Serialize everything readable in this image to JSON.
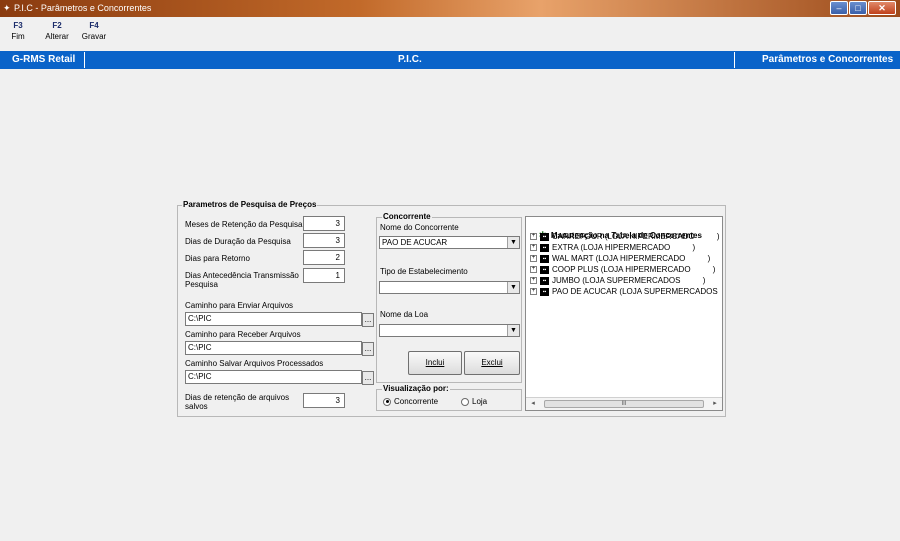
{
  "window": {
    "title": "P.I.C - Parâmetros e Concorrentes",
    "controls": {
      "minimize": "–",
      "maximize": "□",
      "close": "✕"
    }
  },
  "toolbar": [
    {
      "key": "F3",
      "label": "Fim"
    },
    {
      "key": "F2",
      "label": "Alterar"
    },
    {
      "key": "F4",
      "label": "Gravar"
    }
  ],
  "banner": {
    "left": "G-RMS Retail",
    "center": "P.I.C.",
    "right": "Parâmetros e Concorrentes",
    "color": "#0a63c9"
  },
  "params": {
    "legend": "Parametros de Pesquisa de Preços",
    "fields": [
      {
        "label": "Meses de Retenção da Pesquisa",
        "value": "3"
      },
      {
        "label": "Dias de Duração da Pesquisa",
        "value": "3"
      },
      {
        "label": "Dias para Retorno",
        "value": "2"
      },
      {
        "label": "Dias Antecedência Transmissão Pesquisa",
        "value": "1"
      }
    ],
    "paths": [
      {
        "label": "Caminho para Enviar Arquivos",
        "value": "C:\\PIC",
        "button": "..."
      },
      {
        "label": "Caminho para Receber Arquivos",
        "value": "C:\\PIC",
        "button": "..."
      },
      {
        "label": "Caminho Salvar Arquivos Processados",
        "value": "C:\\PIC",
        "button": "..."
      }
    ],
    "retention": {
      "label": "Dias de retenção de arquivos salvos",
      "value": "3"
    }
  },
  "concorrente": {
    "legend": "Concorrente",
    "nome_label": "Nome do Concorrente",
    "nome_value": "PAO DE ACUCAR",
    "tipo_label": "Tipo de Estabelecimento",
    "tipo_value": "",
    "loja_label": "Nome da Loa",
    "loja_value": "",
    "incluir": "Inclui",
    "excluir": "Exclui"
  },
  "visualizacao": {
    "legend": "Visualização por:",
    "options": [
      "Concorrente",
      "Loja"
    ],
    "selected": "Concorrente"
  },
  "tree": {
    "root": "Manutenção na Tabela de Concorrentes",
    "items": [
      "CARREFOUR (LOJA HIPERMERCADO          )",
      "EXTRA (LOJA HIPERMERCADO          )",
      "WAL MART (LOJA HIPERMERCADO          )",
      "COOP PLUS (LOJA HIPERMERCADO          )",
      "JUMBO (LOJA SUPERMERCADOS          )",
      "PAO DE ACUCAR (LOJA SUPERMERCADOS"
    ],
    "scroll_thumb": "III"
  }
}
